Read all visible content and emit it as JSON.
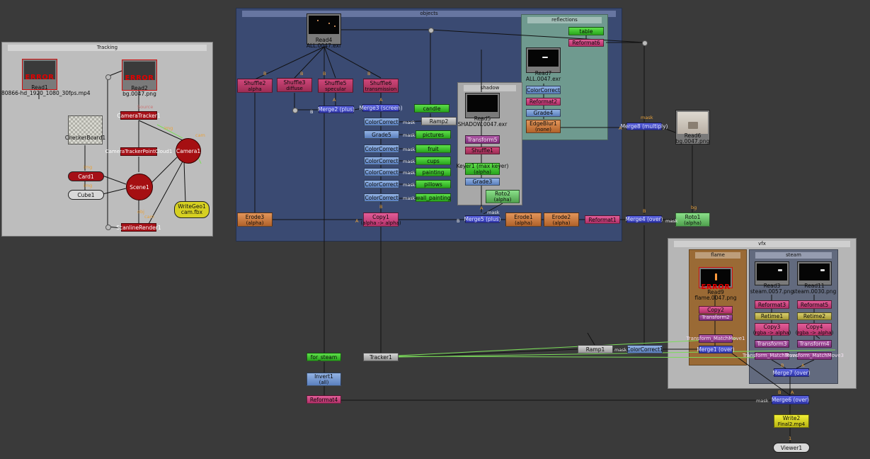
{
  "backdrops": {
    "tracking": "Tracking",
    "objects": "objects",
    "reflections": "reflections",
    "shadow": "shadow",
    "vfx": "vfx",
    "flame": "flame",
    "steam": "steam"
  },
  "errors": {
    "read1": "ERROR",
    "read2": "ERROR",
    "read9": "ERROR"
  },
  "nodes": {
    "read1": [
      "Read1",
      "80866-hd_1920_1080_30fps.mp4"
    ],
    "read2": [
      "Read2",
      "bg.0047.png"
    ],
    "camera_tracker": "CameraTracker1",
    "camera_tracker_pc": "CameraTrackerPointCloud1",
    "camera": "Camera1",
    "checkerboard": "CheckerBoard1",
    "card": "Card1",
    "cube": "Cube1",
    "scene": "Scene1",
    "scanline": "ScanlineRender1",
    "writegeo": [
      "WriteGeo1",
      "cam.fbx"
    ],
    "read4": [
      "Read4",
      "ALL.0047.exr"
    ],
    "shuffle2": [
      "Shuffle2",
      "alpha"
    ],
    "shuffle3": [
      "Shuffle3",
      "diffuse"
    ],
    "shuffle5": [
      "Shuffle5",
      "specular"
    ],
    "shuffle6": [
      "Shuffle6",
      "transmission"
    ],
    "merge2": "Merge2 (plus)",
    "merge3": "Merge3 (screen)",
    "cc1": "ColorCorrect",
    "grade5": "Grade5",
    "cc2": "ColorCorrect",
    "cc3": "ColorCorrect",
    "cc4": "ColorCorrect",
    "cc5": "ColorCorrect",
    "cc6": "ColorCorrect",
    "candle": "candle",
    "ramp2": "Ramp2",
    "pictures": "pictures",
    "fruit": "fruit",
    "cups": "cups",
    "painting": "painting",
    "pillows": "pillows",
    "wall_painting": "wall_painting",
    "read5": [
      "Read5",
      "SHADOW.0047.exr"
    ],
    "transform5": "Transform5",
    "shuffle1": "Shuffle1",
    "keyer1": [
      "Keyer1 (max keyer)",
      "(alpha)"
    ],
    "grade3": "Grade3",
    "roto2": [
      "Roto2",
      "(alpha)"
    ],
    "table": "table",
    "reformat6": "Reformat6",
    "read7": [
      "Read7",
      "ALL.0047.exr"
    ],
    "cc_refl": "ColorCorrect",
    "reformat2": "Reformat2",
    "grade4": "Grade4",
    "edgeblur1": [
      "EdgeBlur1",
      "(none)"
    ],
    "merge8": "Merge8 (multiply)",
    "read6": [
      "Read6",
      "bg.0047.png"
    ],
    "erode3": [
      "Erode3",
      "(alpha)"
    ],
    "copy1": [
      "Copy1",
      "(alpha -> alpha)"
    ],
    "merge5": "Merge5 (plus)",
    "erode1": [
      "Erode1",
      "(alpha)"
    ],
    "erode2": [
      "Erode2",
      "(alpha)"
    ],
    "reformat1": "Reformat1",
    "merge4": "Merge4 (over)",
    "roto1": [
      "Roto1",
      "(alpha)"
    ],
    "read9": [
      "Read9",
      "flame.0047.png"
    ],
    "copy2": "Copy2",
    "transform2": "Transform2",
    "t_matchmove1": "Transform_MatchMove1",
    "merge1": "Merge1 (over)",
    "read3": [
      "Read3",
      "steam.0057.png"
    ],
    "read11": [
      "Read11",
      "steam.0030.png"
    ],
    "reformat3": "Reformat3",
    "reformat5": "Reformat5",
    "retime1": "Retime1",
    "retime2": "Retime2",
    "copy3": [
      "Copy3",
      "(rgba -> alpha)"
    ],
    "copy4": [
      "Copy4",
      "(rgba -> alpha)"
    ],
    "transform3": "Transform3",
    "transform4": "Transform4",
    "t_matchmove2": "Transform_MatchMove2",
    "t_matchmove3": "Transform_MatchMove3",
    "merge7": "Merge7 (over)",
    "for_steam": "for_steam",
    "invert1": [
      "Invert1",
      "(all)"
    ],
    "reformat4": "Reformat4",
    "tracker1": "Tracker1",
    "ramp1": "Ramp1",
    "cc_bottom": "ColorCorrect1",
    "merge6": "Merge6 (over)",
    "write2": [
      "Write2",
      "Final2.mp4"
    ],
    "viewer1": "Viewer1"
  },
  "pipe_labels": {
    "B": "B",
    "A": "A",
    "mask": "mask",
    "bg": "bg",
    "img": "img",
    "cam": "cam",
    "obj": "obj",
    "src": "Source",
    "one": "1",
    "cam_out": "cam"
  },
  "colors": {
    "background": "#3a3a3a",
    "tracking": "#bdbdbd",
    "objects": "#3a4a72",
    "reflections": "#6f9a8f",
    "shadow": "#a8a8a8",
    "vfx": "#b6b6b6",
    "flame": "#9a6a35",
    "steam": "#626a7e"
  }
}
